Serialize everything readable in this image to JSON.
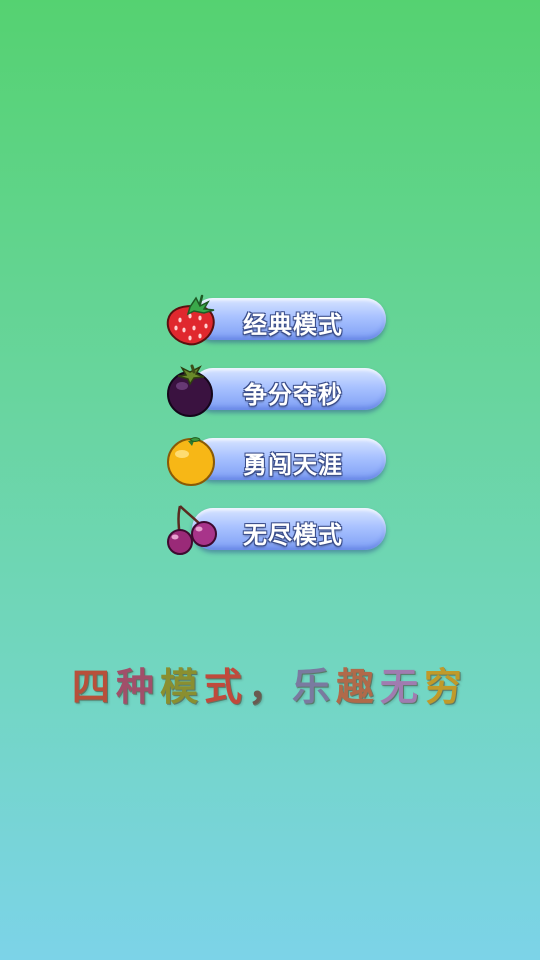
{
  "menu": {
    "modes": [
      {
        "label": "经典模式",
        "icon": "strawberry-icon"
      },
      {
        "label": "争分夺秒",
        "icon": "mangosteen-icon"
      },
      {
        "label": "勇闯天涯",
        "icon": "orange-icon"
      },
      {
        "label": "无尽模式",
        "icon": "cherry-icon"
      }
    ]
  },
  "tagline": {
    "text": "四种模式，乐趣无穷",
    "colors": [
      "#b8503a",
      "#a14f6a",
      "#8a8f30",
      "#c04a3c",
      "#6a5a50",
      "#7a7aa0",
      "#b06a4a",
      "#a07cb0",
      "#c09a2a"
    ]
  }
}
